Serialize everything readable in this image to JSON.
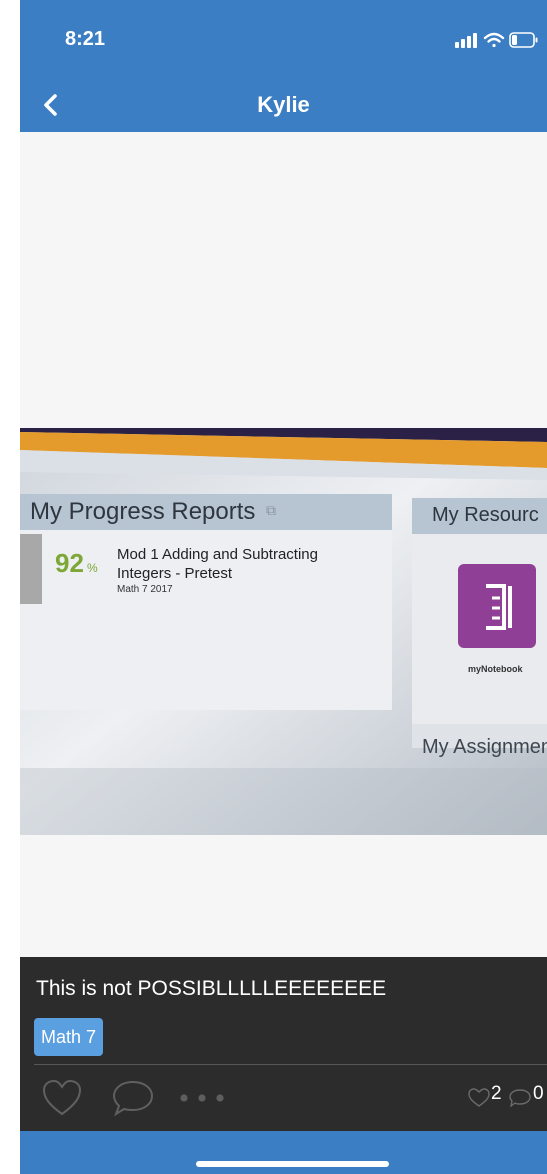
{
  "status_bar": {
    "time": "8:21",
    "icons": [
      "signal-icon",
      "wifi-icon",
      "battery-icon"
    ]
  },
  "nav": {
    "title": "Kylie",
    "back_icon": "chevron-left-icon"
  },
  "photo": {
    "progress_header": "My Progress Reports",
    "score": "92",
    "score_unit": "%",
    "item_title_line1": "Mod 1 Adding and Subtracting",
    "item_title_line2": "Integers - Pretest",
    "item_course": "Math 7 2017",
    "resources_header": "My Resourc",
    "notebook_label": "myNotebook",
    "assignments_header": "My Assignmen"
  },
  "post": {
    "caption": "This is not POSSIBLLLLLEEEEEEEE",
    "tag": "Math 7",
    "like_count": "2",
    "comment_count": "0"
  },
  "colors": {
    "primary": "#3c7ec4",
    "panel": "#2c2c2c",
    "tag": "#5a9fe0"
  }
}
